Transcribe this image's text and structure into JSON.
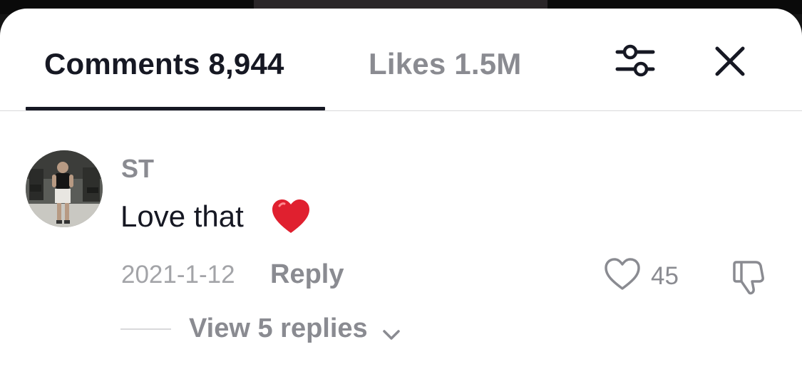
{
  "tabs": {
    "comments_label": "Comments 8,944",
    "likes_label": "Likes 1.5M",
    "active": "comments"
  },
  "icons": {
    "filter": "sliders-icon",
    "close": "close-icon",
    "like": "heart-outline-icon",
    "dislike": "thumbs-down-icon",
    "emoji": "red-heart-emoji",
    "expand": "chevron-down-icon"
  },
  "colors": {
    "primary_text": "#161823",
    "secondary_text": "#8a8b91",
    "muted_text": "#a3a4a8",
    "heart_emoji": "#e0202f",
    "divider": "#d9d9db"
  },
  "comment": {
    "username": "ST",
    "text": "Love that",
    "date": "2021-1-12",
    "reply_label": "Reply",
    "like_count": "45",
    "view_replies_label": "View 5 replies"
  }
}
